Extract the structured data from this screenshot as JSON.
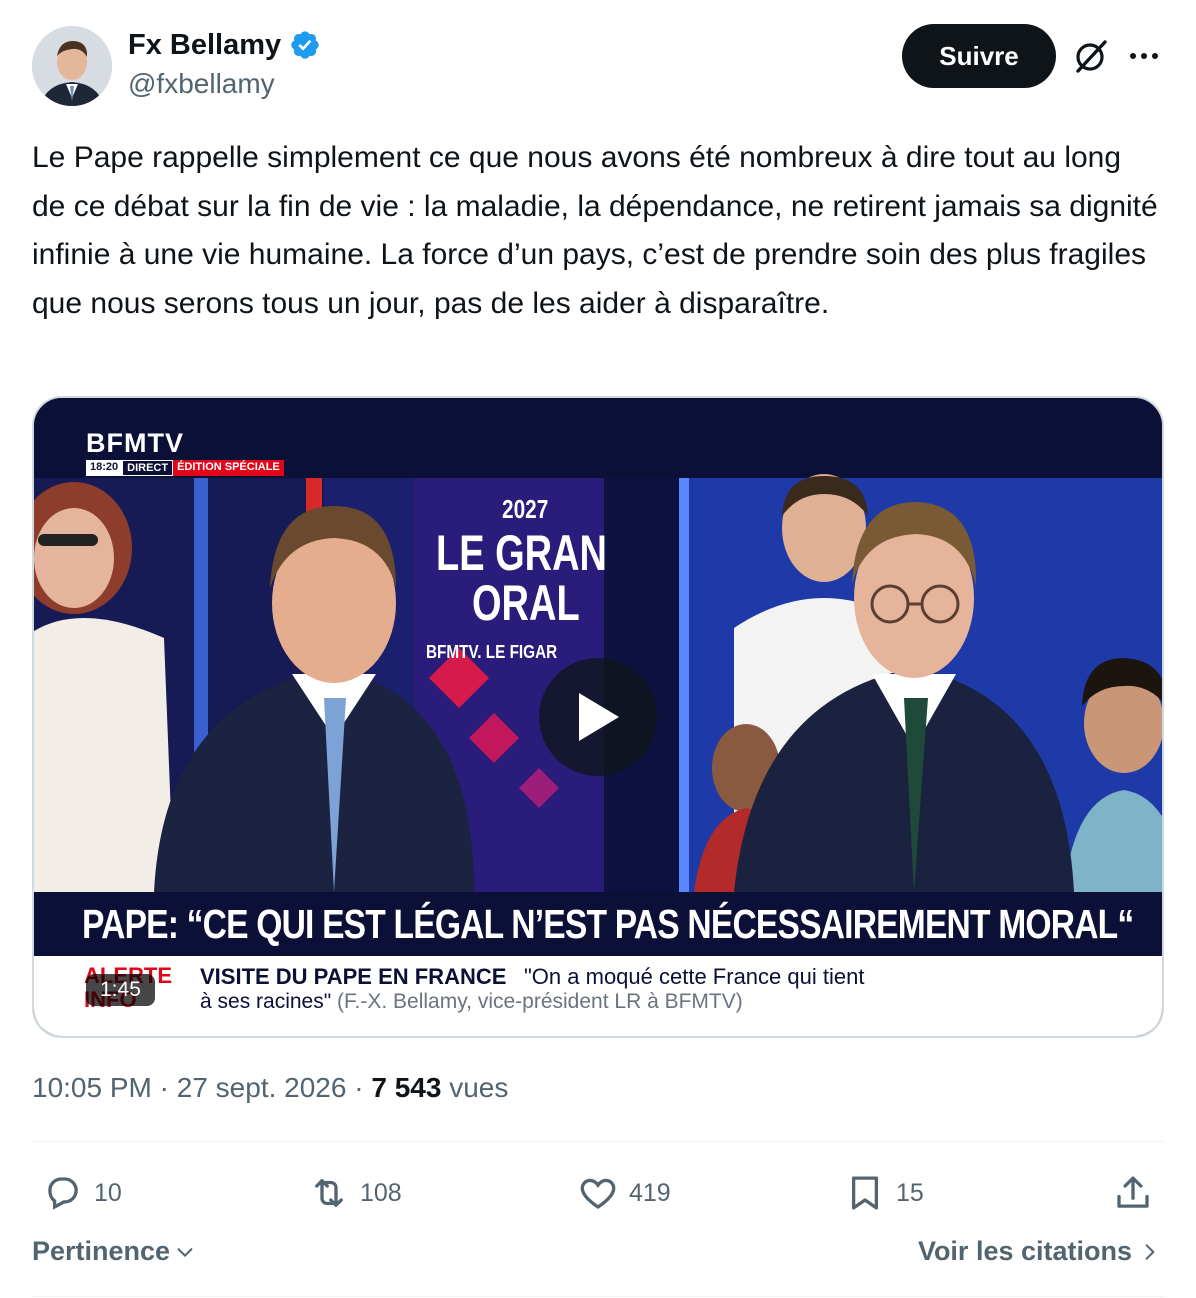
{
  "author": {
    "display_name": "Fx Bellamy",
    "handle": "@fxbellamy",
    "verified": true
  },
  "header": {
    "follow_label": "Suivre",
    "grok_icon": "grok-icon",
    "more_icon": "more-icon"
  },
  "tweet": {
    "text": "Le Pape rappelle simplement ce que nous avons été nombreux à dire tout au long de ce débat sur la fin de vie : la maladie, la dépendance, ne retirent jamais sa dignité infinie à une vie humaine. La force d’un pays, c’est de prendre soin des plus fragiles que nous serons tous un jour, pas de les aider à disparaître."
  },
  "video": {
    "channel": "BFMTV",
    "live_time": "18:20",
    "live_label": "DIRECT",
    "special_label": "ÉDITION SPÉCIALE",
    "set_year": "2027",
    "set_title_1": "LE GRAN",
    "set_title_2": "ORAL",
    "set_partners": "BFMTV. LE FIGAR",
    "headline": "PAPE: “CE QUI EST LÉGAL N’EST PAS NÉCESSAIREMENT MORAL“",
    "ticker_alert": "ALERTE INFO",
    "ticker_title": "VISITE DU PAPE EN FRANCE",
    "ticker_quote": "\"On a moqué cette France qui tient",
    "ticker_quote_cont": "à ses racines\"",
    "ticker_source": "(F.-X. Bellamy, vice-président LR à BFMTV)",
    "duration": "1:45"
  },
  "meta": {
    "time": "10:05 PM",
    "separator": "·",
    "date": "27 sept. 2026",
    "views_count": "7 543",
    "views_label": "vues"
  },
  "actions": {
    "replies": "10",
    "reposts": "108",
    "likes": "419",
    "bookmarks": "15"
  },
  "footer": {
    "sort_label": "Pertinence",
    "quotes_label": "Voir les citations"
  },
  "colors": {
    "text_primary": "#0f1419",
    "text_secondary": "#536471",
    "verified_blue": "#1d9bf0",
    "bfm_navy": "#0c0f36",
    "bfm_red": "#e2061b"
  }
}
